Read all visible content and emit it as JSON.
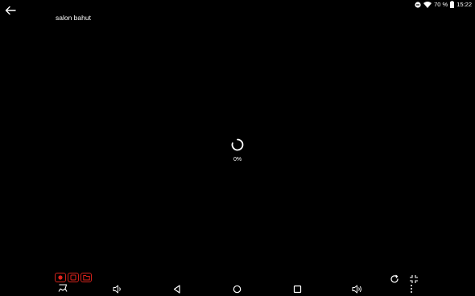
{
  "status_bar": {
    "battery_text": "70 %",
    "time": "15:22",
    "icons": [
      "do-not-disturb-icon",
      "wifi-icon",
      "battery-icon"
    ]
  },
  "header": {
    "camera_name": "salon bahut"
  },
  "player": {
    "loading_percent_text": "0%",
    "loading_progress": 0
  },
  "record_controls": {
    "accent_color": "#d0221b",
    "buttons": [
      "record-icon",
      "snapshot-icon",
      "folder-icon"
    ]
  },
  "nav_bar": {
    "buttons": [
      "accessibility-icon",
      "volume-down-icon",
      "back-icon",
      "home-icon",
      "recents-icon",
      "volume-up-icon"
    ]
  },
  "side_controls": {
    "buttons": [
      "refresh-icon",
      "exit-fullscreen-icon",
      "more-vertical-icon"
    ]
  }
}
